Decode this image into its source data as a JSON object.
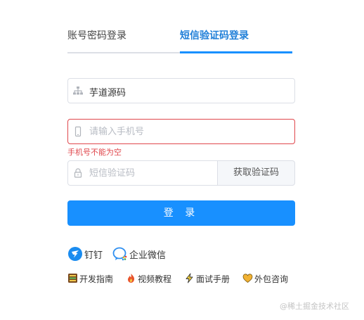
{
  "tabs": {
    "account_label": "账号密码登录",
    "sms_label": "短信验证码登录",
    "active": "sms"
  },
  "form": {
    "tenant_value": "芋道源码",
    "phone_placeholder": "请输入手机号",
    "phone_error": "手机号不能为空",
    "code_placeholder": "短信验证码",
    "get_code_label": "获取验证码",
    "login_label": "登 录"
  },
  "social_login": [
    {
      "label": "钉钉",
      "icon": "dingtalk-icon"
    },
    {
      "label": "企业微信",
      "icon": "wecom-icon"
    }
  ],
  "links": [
    {
      "label": "开发指南",
      "icon": "book-icon"
    },
    {
      "label": "视频教程",
      "icon": "fire-icon"
    },
    {
      "label": "面试手册",
      "icon": "lightning-icon"
    },
    {
      "label": "外包咨询",
      "icon": "heart-icon"
    }
  ],
  "watermark": "@稀土掘金技术社区",
  "colors": {
    "primary": "#1890ff",
    "active_tab": "#1f7fd8",
    "error": "#e0474c",
    "border": "#dcdfe6"
  }
}
